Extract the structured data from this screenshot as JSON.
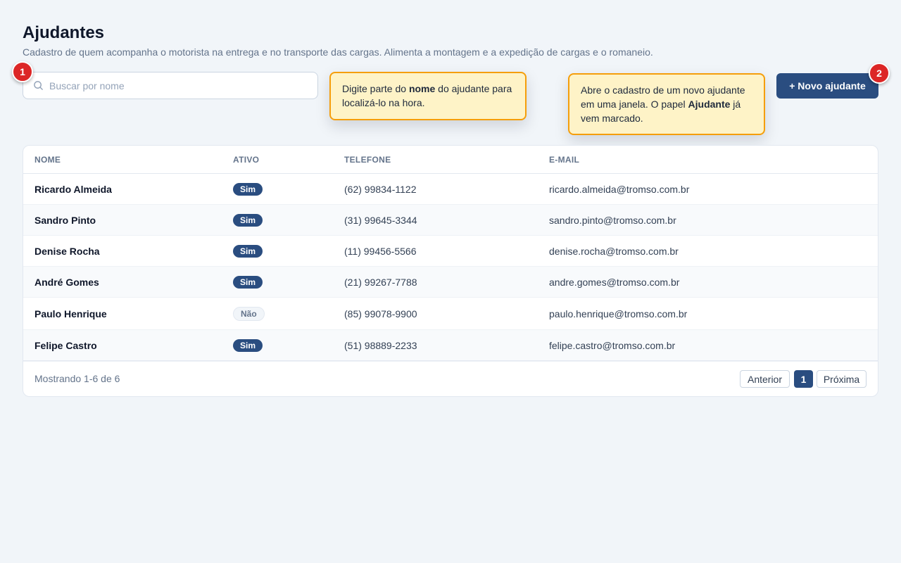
{
  "header": {
    "title": "Ajudantes",
    "subtitle": "Cadastro de quem acompanha o motorista na entrega e no transporte das cargas. Alimenta a montagem e a expedição de cargas e o romaneio."
  },
  "search": {
    "placeholder": "Buscar por nome",
    "value": ""
  },
  "tour": {
    "step1": "1",
    "step2": "2",
    "tip1": {
      "before": "Digite parte do ",
      "bold": "nome",
      "after": " do ajudante para localizá-lo na hora."
    },
    "tip2": {
      "before": "Abre o cadastro de um novo ajudante em uma janela. O papel ",
      "bold": "Ajudante",
      "after": " já vem marcado."
    }
  },
  "actions": {
    "new_label": "+ Novo ajudante"
  },
  "table": {
    "columns": [
      "NOME",
      "ATIVO",
      "TELEFONE",
      "E-MAIL"
    ],
    "rows": [
      {
        "name": "Ricardo Almeida",
        "active": "Sim",
        "phone": "(62) 99834-1122",
        "email": "ricardo.almeida@tromso.com.br"
      },
      {
        "name": "Sandro Pinto",
        "active": "Sim",
        "phone": "(31) 99645-3344",
        "email": "sandro.pinto@tromso.com.br"
      },
      {
        "name": "Denise Rocha",
        "active": "Sim",
        "phone": "(11) 99456-5566",
        "email": "denise.rocha@tromso.com.br"
      },
      {
        "name": "André Gomes",
        "active": "Sim",
        "phone": "(21) 99267-7788",
        "email": "andre.gomes@tromso.com.br"
      },
      {
        "name": "Paulo Henrique",
        "active": "Não",
        "phone": "(85) 99078-9900",
        "email": "paulo.henrique@tromso.com.br"
      },
      {
        "name": "Felipe Castro",
        "active": "Sim",
        "phone": "(51) 98889-2233",
        "email": "felipe.castro@tromso.com.br"
      }
    ]
  },
  "footer": {
    "showing": "Mostrando 1-6 de 6",
    "prev": "Anterior",
    "page": "1",
    "next": "Próxima"
  },
  "colors": {
    "primary": "#2a4d80",
    "badge": "#dc2626",
    "tooltip_bg": "#fef3c7",
    "tooltip_border": "#f59e0b"
  },
  "icons": {
    "search": "search-icon"
  }
}
